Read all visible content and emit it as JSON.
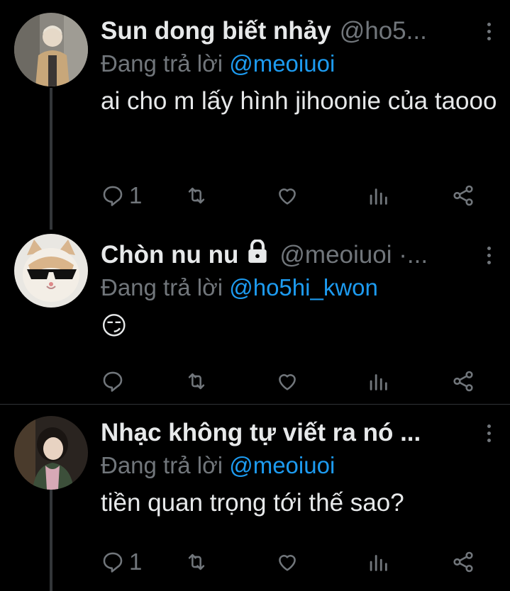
{
  "tweets": [
    {
      "name": "Sun dong biết nhảy",
      "handle": "@ho5...",
      "reply_prefix": "Đang trả lời",
      "reply_to": "@meoiuoi",
      "text": "ai cho m lấy hình jihoonie của taooo",
      "reply_count": "1",
      "avatar": "person-avatar"
    },
    {
      "name": "Chòn nu nu",
      "handle": "@meoiuoi ·...",
      "reply_prefix": "Đang trả lời",
      "reply_to": "@ho5hi_kwon",
      "text": "😏",
      "reply_count": "",
      "avatar": "cat-sunglasses-avatar",
      "locked": true
    },
    {
      "name": "Nhạc không tự viết ra nó ...",
      "handle": "",
      "reply_prefix": "Đang trả lời",
      "reply_to": "@meoiuoi",
      "text": "tiền quan trọng tới thế sao?",
      "reply_count": "1",
      "avatar": "person-avatar"
    }
  ],
  "colors": {
    "background": "#000000",
    "primary_text": "#e7e9ea",
    "secondary_text": "#71767b",
    "mention": "#1d9bf0",
    "divider": "#2f3336"
  },
  "icons": [
    "reply-icon",
    "retweet-icon",
    "like-icon",
    "views-icon",
    "share-icon",
    "more-icon",
    "lock-icon"
  ]
}
